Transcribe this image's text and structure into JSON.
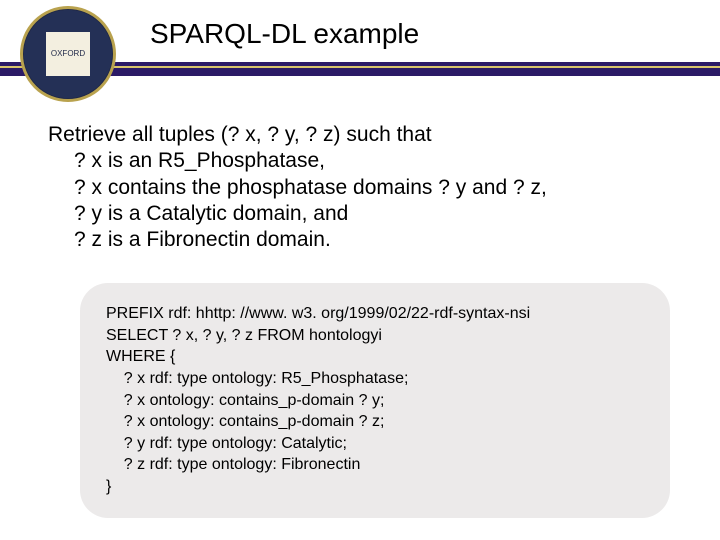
{
  "header": {
    "title": "SPARQL-DL example",
    "crest_text": "OXFORD"
  },
  "description": {
    "line0": "Retrieve all tuples (? x, ? y, ? z) such that",
    "line1": "? x is an R5_Phosphatase,",
    "line2": "? x contains the phosphatase domains ? y and ? z,",
    "line3": "? y is a Catalytic domain, and",
    "line4": "? z is a Fibronectin domain."
  },
  "code": {
    "line0": "PREFIX rdf: hhttp: //www. w3. org/1999/02/22-rdf-syntax-nsi",
    "line1": "SELECT ? x, ? y, ? z FROM hontologyi",
    "line2": "WHERE {",
    "line3": "    ? x rdf: type ontology: R5_Phosphatase;",
    "line4": "    ? x ontology: contains_p-domain ? y;",
    "line5": "    ? x ontology: contains_p-domain ? z;",
    "line6": "    ? y rdf: type ontology: Catalytic;",
    "line7": "    ? z rdf: type ontology: Fibronectin",
    "line8": "}"
  }
}
